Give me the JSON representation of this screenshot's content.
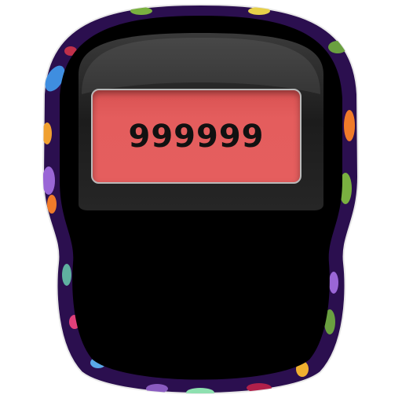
{
  "counter": {
    "value": "999999"
  },
  "colors": {
    "border": "#2b0f4f",
    "body": "#000000",
    "display": "#e35c5c"
  },
  "icons": [
    "floral-pattern-border"
  ]
}
